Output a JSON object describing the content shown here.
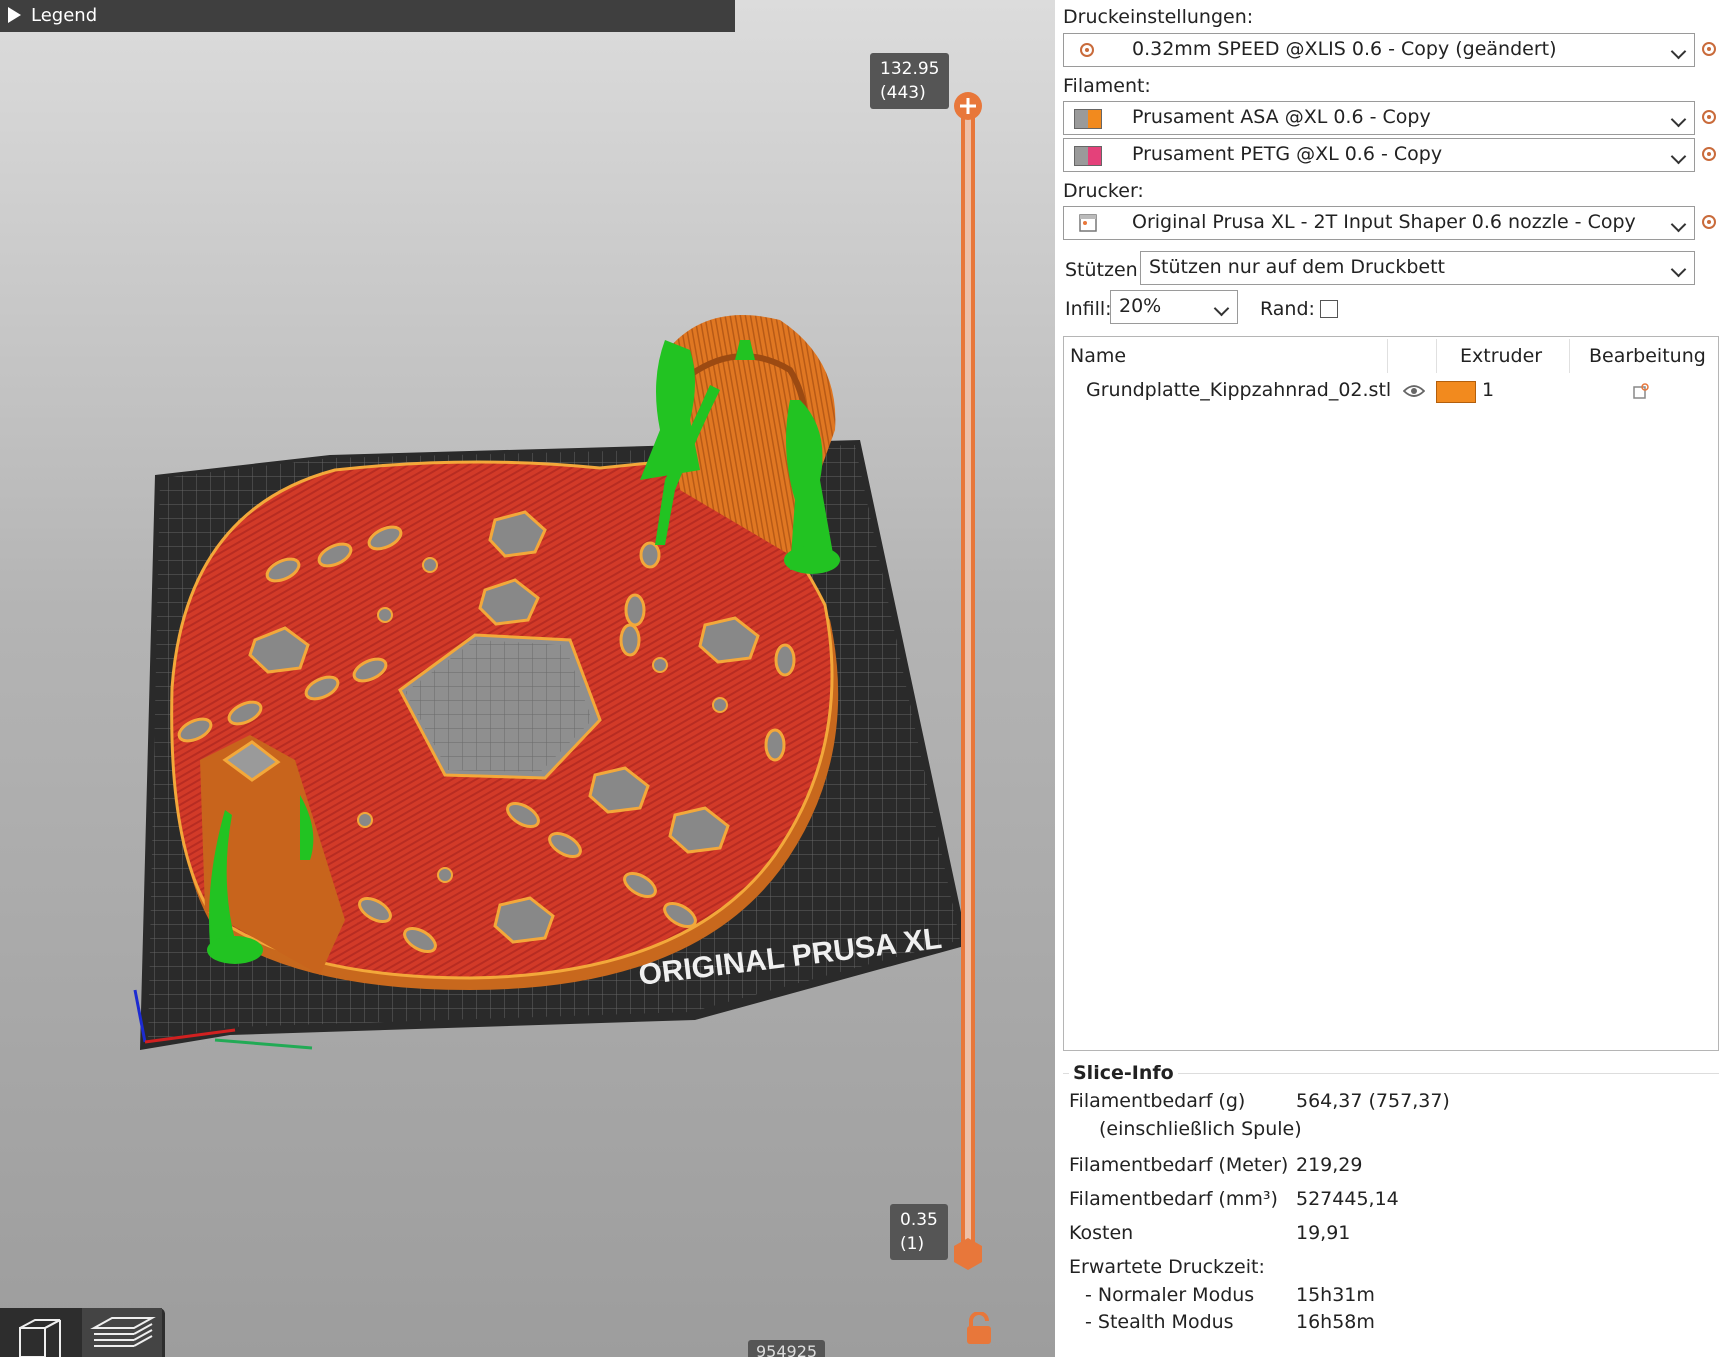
{
  "viewport": {
    "legend_label": "Legend",
    "layer_top": {
      "height": "132.95",
      "layer": "(443)"
    },
    "layer_bottom": {
      "height": "0.35",
      "layer": "(1)"
    },
    "bed_text": "ORIGINAL PRUSA XL",
    "move_counter": "954925",
    "colors": {
      "perimeter": "#e0751c",
      "infill": "#d4372a",
      "support": "#22c322",
      "slider": "#e8773a"
    }
  },
  "panel": {
    "print_settings": {
      "label": "Druckeinstellungen:",
      "value": "0.32mm SPEED @XLIS 0.6 - Copy (geändert)",
      "icon": "gear-icon"
    },
    "filament": {
      "label": "Filament:",
      "items": [
        {
          "value": "Prusament ASA @XL 0.6 - Copy",
          "color": "#f28a1e"
        },
        {
          "value": "Prusament PETG @XL 0.6 - Copy",
          "color": "#e4417a"
        }
      ]
    },
    "printer": {
      "label": "Drucker:",
      "value": "Original Prusa XL - 2T Input Shaper 0.6 nozzle - Copy",
      "icon": "printer-icon"
    },
    "supports": {
      "label": "Stützen:",
      "value": "Stützen nur auf dem Druckbett"
    },
    "infill": {
      "label": "Infill:",
      "value": "20%"
    },
    "brim": {
      "label": "Rand:",
      "checked": false
    },
    "object_table": {
      "headers": {
        "name": "Name",
        "extruder": "Extruder",
        "edit": "Bearbeitung"
      },
      "rows": [
        {
          "name": "Grundplatte_Kippzahnrad_02.stl",
          "extruder": "1",
          "extruder_color": "#f28a1e",
          "icons": [
            "eye-icon",
            "edit-icon"
          ]
        }
      ]
    },
    "slice_info": {
      "title": "Slice-Info",
      "rows": [
        {
          "label": "Filamentbedarf (g)",
          "sub": "(einschließlich Spule)",
          "value": "564,37 (757,37)"
        },
        {
          "label": "Filamentbedarf (Meter)",
          "value": "219,29"
        },
        {
          "label": "Filamentbedarf (mm³)",
          "value": "527445,14"
        },
        {
          "label": "Kosten",
          "value": "19,91"
        },
        {
          "label": "Erwartete Druckzeit:",
          "value": ""
        },
        {
          "label": "- Normaler Modus",
          "value": "15h31m"
        },
        {
          "label": "- Stealth Modus",
          "value": "16h58m"
        }
      ]
    }
  }
}
